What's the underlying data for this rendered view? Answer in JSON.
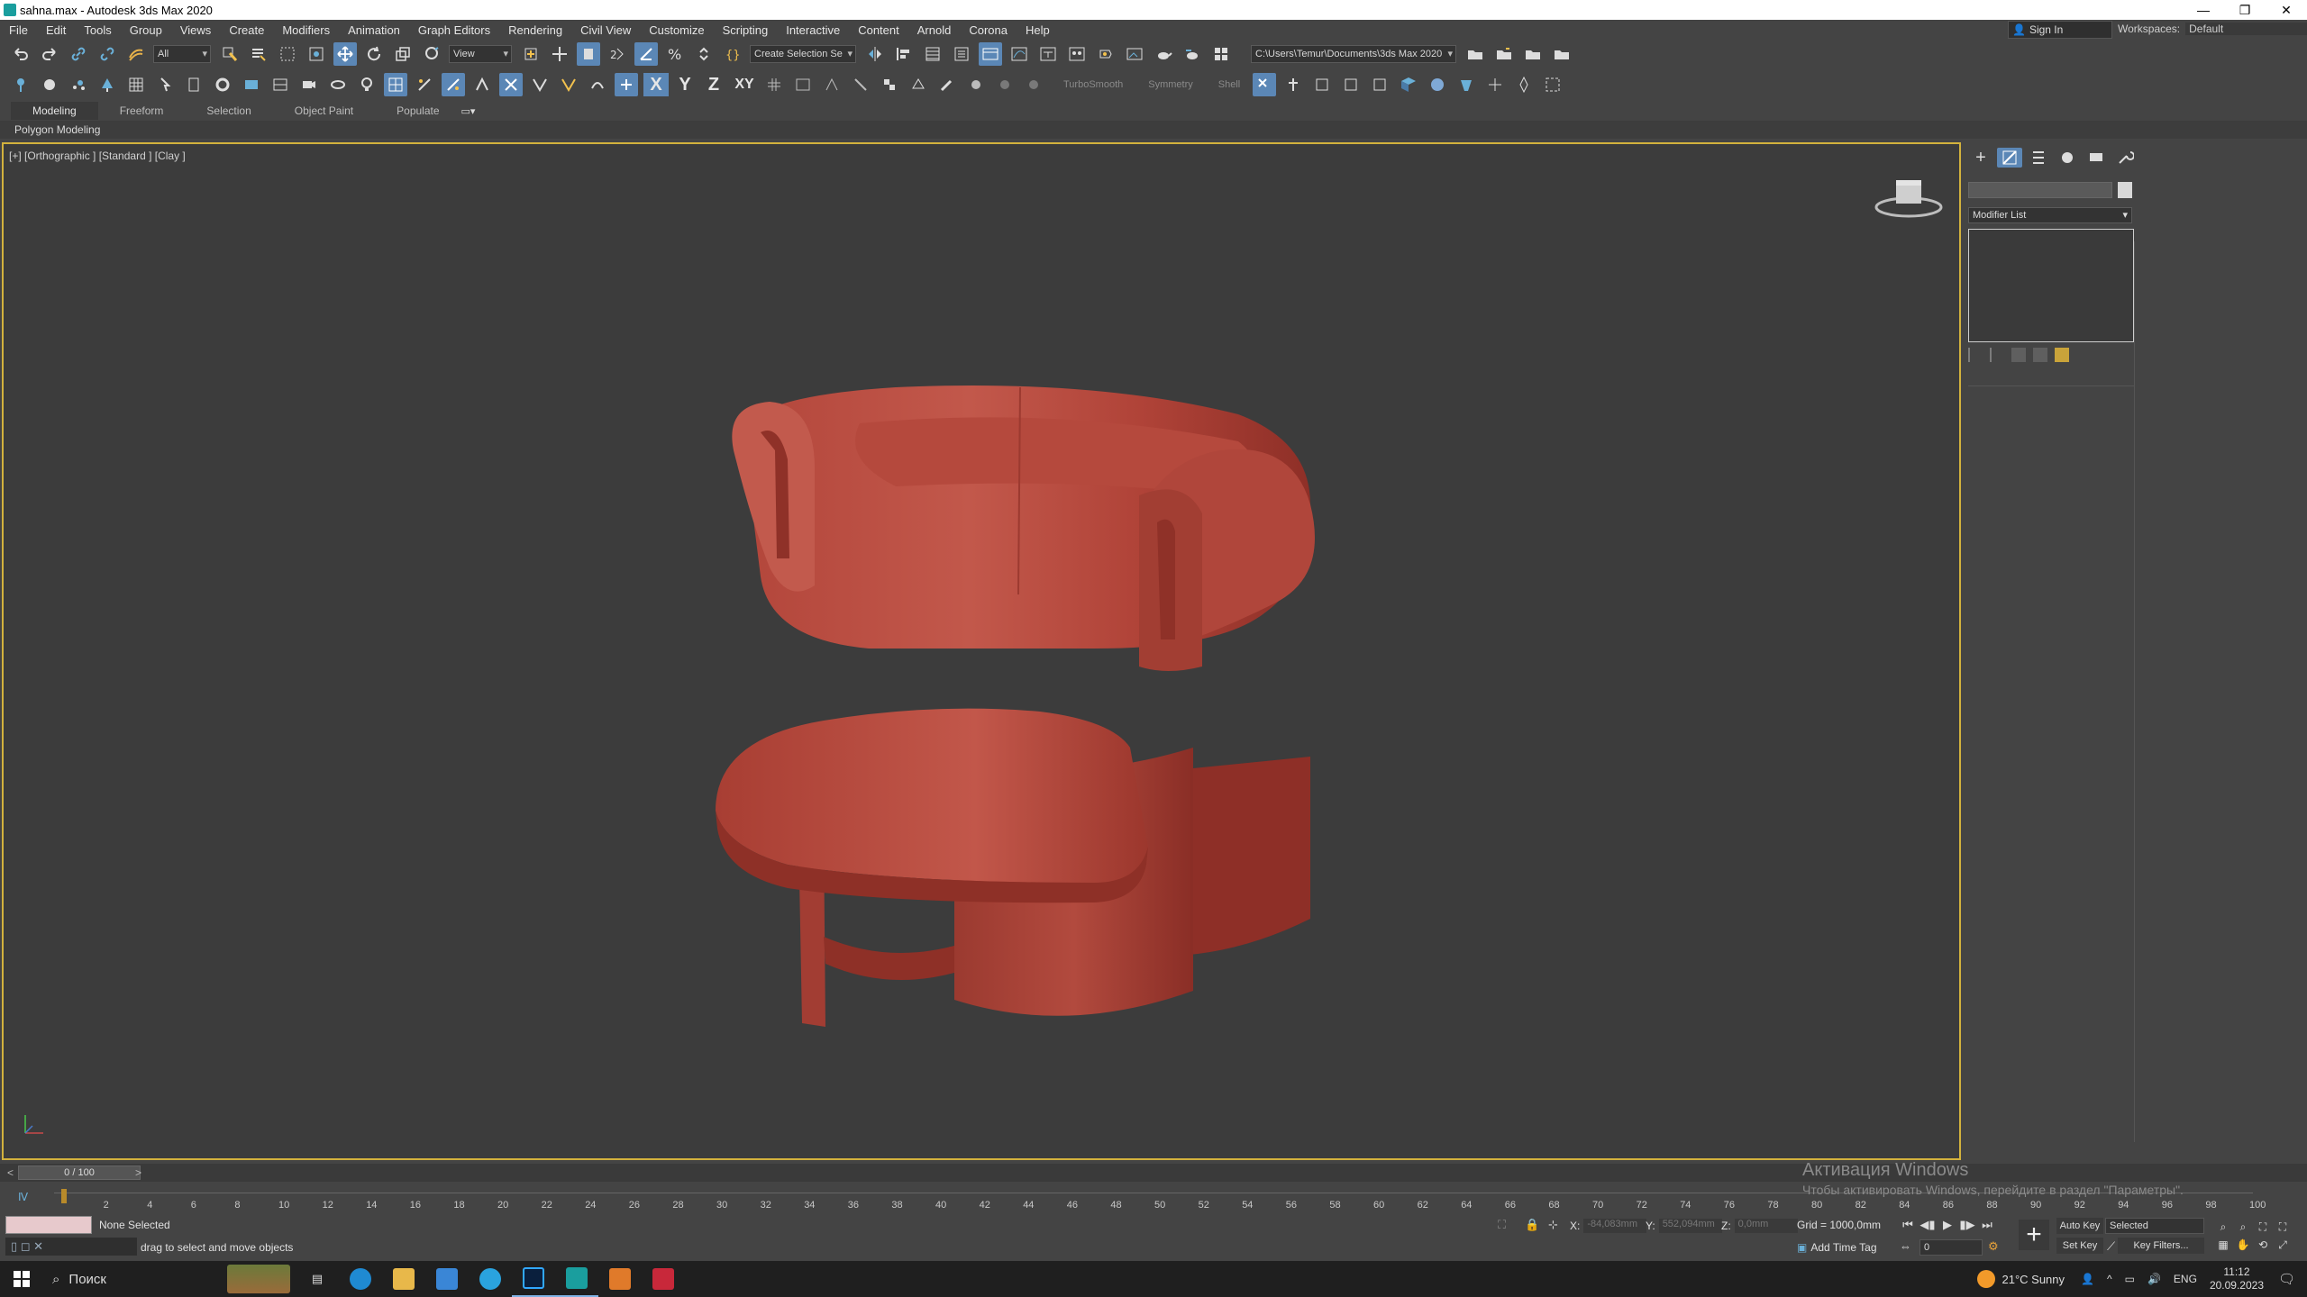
{
  "window": {
    "title": "sahna.max - Autodesk 3ds Max 2020",
    "controls": [
      "—",
      "❐",
      "✕"
    ]
  },
  "menu": [
    "File",
    "Edit",
    "Tools",
    "Group",
    "Views",
    "Create",
    "Modifiers",
    "Animation",
    "Graph Editors",
    "Rendering",
    "Civil View",
    "Customize",
    "Scripting",
    "Interactive",
    "Content",
    "Arnold",
    "Corona",
    "Help"
  ],
  "account": {
    "sign_in": "Sign In",
    "workspaces_label": "Workspaces:",
    "workspace": "Default"
  },
  "toolbar": {
    "selection_filter": "All",
    "ref_coord": "View",
    "named_selection": "Create Selection Se",
    "project_path": "C:\\Users\\Temur\\Documents\\3ds Max 2020",
    "axis_x": "X",
    "axis_y": "Y",
    "axis_z": "Z",
    "axis_xy": "XY",
    "turbosmooth": "TurboSmooth",
    "symmetry": "Symmetry",
    "shell": "Shell"
  },
  "ribbon": {
    "tabs": [
      "Modeling",
      "Freeform",
      "Selection",
      "Object Paint",
      "Populate"
    ],
    "panel": "Polygon Modeling"
  },
  "viewport": {
    "label": "[+] [Orthographic ] [Standard ] [Clay ]",
    "object_color": "#b5453a"
  },
  "command_panel": {
    "modifier_list": "Modifier List"
  },
  "timeline": {
    "frame_display": "0 / 100",
    "ticks": [
      "0",
      "2",
      "4",
      "6",
      "8",
      "10",
      "12",
      "14",
      "16",
      "18",
      "20",
      "22",
      "24",
      "26",
      "28",
      "30",
      "32",
      "34",
      "36",
      "38",
      "40",
      "42",
      "44",
      "46",
      "48",
      "50",
      "52",
      "54",
      "56",
      "58",
      "60",
      "62",
      "64",
      "66",
      "68",
      "70",
      "72",
      "74",
      "76",
      "78",
      "80",
      "82",
      "84",
      "86",
      "88",
      "90",
      "92",
      "94",
      "96",
      "98",
      "100"
    ]
  },
  "status": {
    "selection": "None Selected",
    "prompt": "drag to select and move objects",
    "x_label": "X:",
    "x_value": "-84,083mm",
    "y_label": "Y:",
    "y_value": "552,094mm",
    "z_label": "Z:",
    "z_value": "0,0mm",
    "grid": "Grid = 1000,0mm",
    "add_time_tag": "Add Time Tag",
    "auto_key": "Auto Key",
    "set_key": "Set Key",
    "key_mode": "Selected",
    "key_filters": "Key Filters...",
    "current_frame": "0"
  },
  "watermark": {
    "line1": "Активация Windows",
    "line2": "Чтобы активировать Windows, перейдите в раздел \"Параметры\"."
  },
  "taskbar": {
    "search": "Поиск",
    "weather": "21°C  Sunny",
    "lang": "ENG",
    "time": "11:12",
    "date": "20.09.2023"
  }
}
